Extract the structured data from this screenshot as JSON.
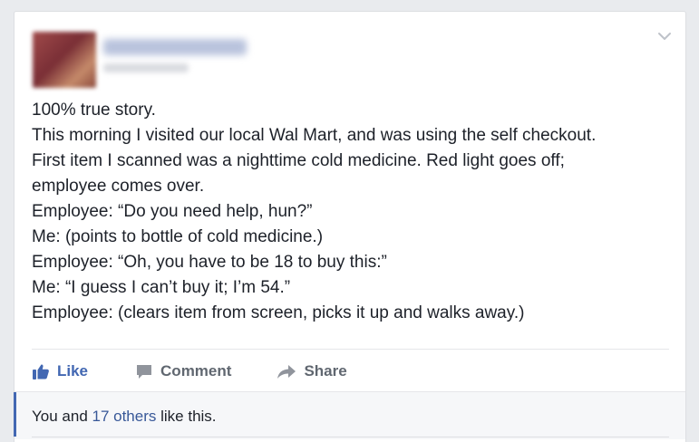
{
  "post": {
    "lines": [
      "100% true story.",
      "This morning I visited our local Wal Mart, and was using the self checkout.",
      "First item I scanned was a nighttime cold medicine. Red light goes off;",
      "employee comes over.",
      "Employee: “Do you need help, hun?”",
      "Me: (points to bottle of cold medicine.)",
      "Employee: “Oh, you have to be 18 to buy this:”",
      "Me: “I guess I can’t buy it; I’m 54.”",
      "Employee: (clears item from screen, picks it up and walks away.)"
    ]
  },
  "actions": {
    "like_label": "Like",
    "comment_label": "Comment",
    "share_label": "Share"
  },
  "likes_summary": {
    "prefix": "You and ",
    "link": "17 others",
    "suffix": " like this."
  },
  "icons": {
    "like": "thumbs-up-icon",
    "comment": "speech-bubble-icon",
    "share": "share-arrow-icon",
    "menu": "chevron-down-icon"
  },
  "colors": {
    "accent": "#4267b2",
    "link": "#385898",
    "text": "#1d2129",
    "muted": "#606770",
    "background": "#e9ebee"
  }
}
